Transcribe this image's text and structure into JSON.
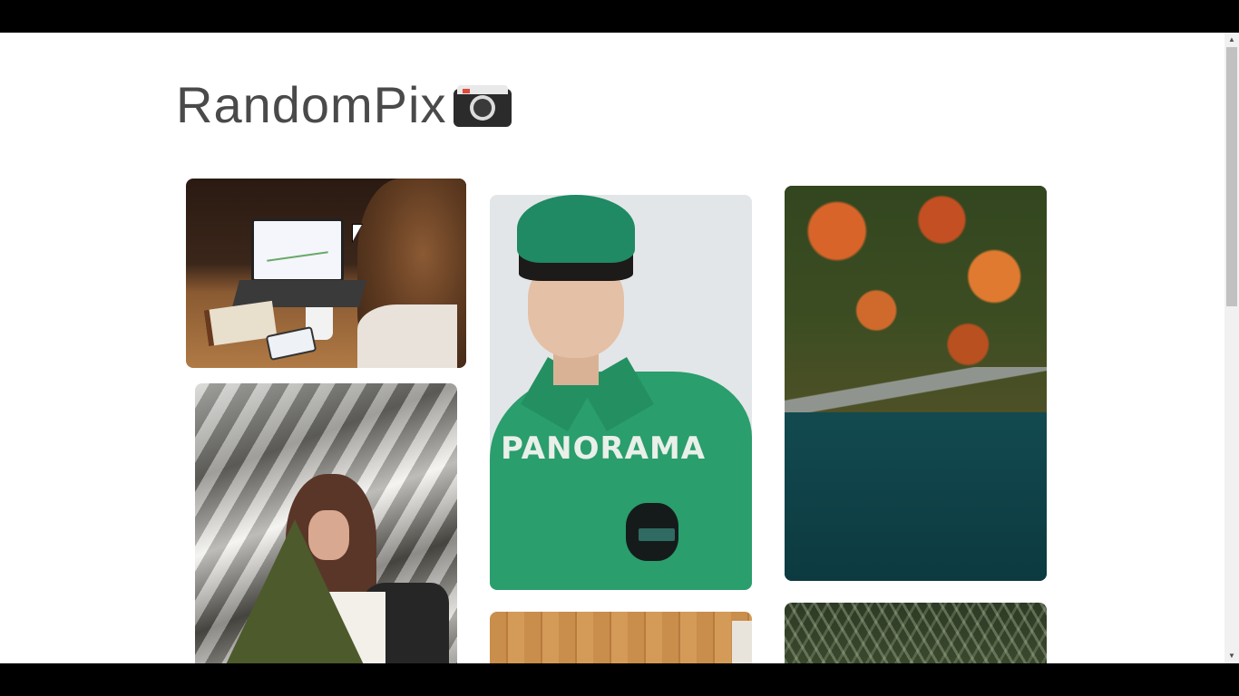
{
  "header": {
    "site_title": "RandomPix"
  },
  "icons": {
    "logo": "camera-icon"
  },
  "gallery": {
    "photos": [
      {
        "subject": "laptop-desk-photo",
        "overlay_text": ""
      },
      {
        "subject": "woman-pine-tree-snow-photo",
        "overlay_text": ""
      },
      {
        "subject": "man-green-shirt-photo",
        "overlay_text": "PANORAMA"
      },
      {
        "subject": "forest-lake-aerial-photo",
        "overlay_text": ""
      },
      {
        "subject": "wood-wall-photo",
        "overlay_text": ""
      },
      {
        "subject": "pine-branches-photo",
        "overlay_text": ""
      }
    ]
  },
  "colors": {
    "title_text": "#4a4a4a",
    "page_background": "#ffffff",
    "chrome": "#000000"
  }
}
